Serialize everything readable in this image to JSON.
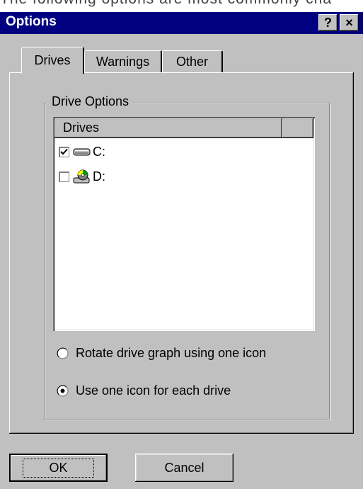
{
  "background_text": "The following options are most commonly cha",
  "window": {
    "title": "Options",
    "help_button": "?",
    "close_button": "×"
  },
  "tabs": [
    {
      "label": "Drives",
      "active": true
    },
    {
      "label": "Warnings",
      "active": false
    },
    {
      "label": "Other",
      "active": false
    }
  ],
  "drive_options": {
    "group_label": "Drive Options",
    "list_header": "Drives",
    "drives": [
      {
        "label": "C:",
        "checked": true,
        "icon": "hard-drive-icon"
      },
      {
        "label": "D:",
        "checked": false,
        "icon": "cdrom-drive-icon"
      }
    ],
    "radio_options": [
      {
        "label": "Rotate drive graph using one icon",
        "selected": false
      },
      {
        "label": "Use one icon for each drive",
        "selected": true
      }
    ]
  },
  "buttons": {
    "ok": "OK",
    "cancel": "Cancel"
  }
}
